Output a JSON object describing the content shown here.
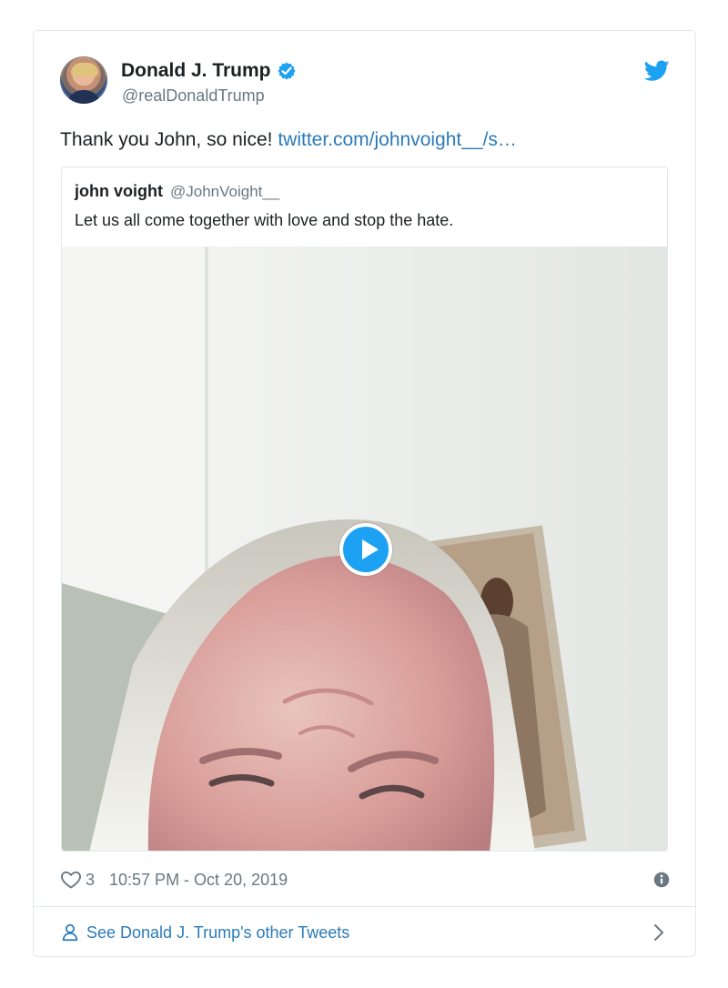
{
  "tweet": {
    "author": {
      "display_name": "Donald J. Trump",
      "handle": "@realDonaldTrump",
      "verified": true
    },
    "text_prefix": "Thank you John, so nice! ",
    "link_text": "twitter.com/johnvoight__/s…",
    "icons": {
      "avatar": "profile-avatar",
      "verified": "verified-badge-icon",
      "brand": "twitter-bird-icon"
    }
  },
  "quote": {
    "display_name": "john voight",
    "handle": "@JohnVoight__",
    "text": "Let us all come together with love and stop the hate.",
    "media": {
      "type": "video",
      "play_icon": "play-icon"
    }
  },
  "meta": {
    "likes": "3",
    "timestamp": "10:57 PM - Oct 20, 2019",
    "icons": {
      "like": "heart-icon",
      "info": "info-icon"
    }
  },
  "footer": {
    "label": "See Donald J. Trump's other Tweets",
    "icons": {
      "person": "person-icon",
      "chevron": "chevron-right-icon"
    }
  },
  "colors": {
    "accent": "#1da1f2",
    "link": "#2b7bb9",
    "text": "#1c2022",
    "muted": "#697882",
    "border": "#e1e8ed"
  }
}
